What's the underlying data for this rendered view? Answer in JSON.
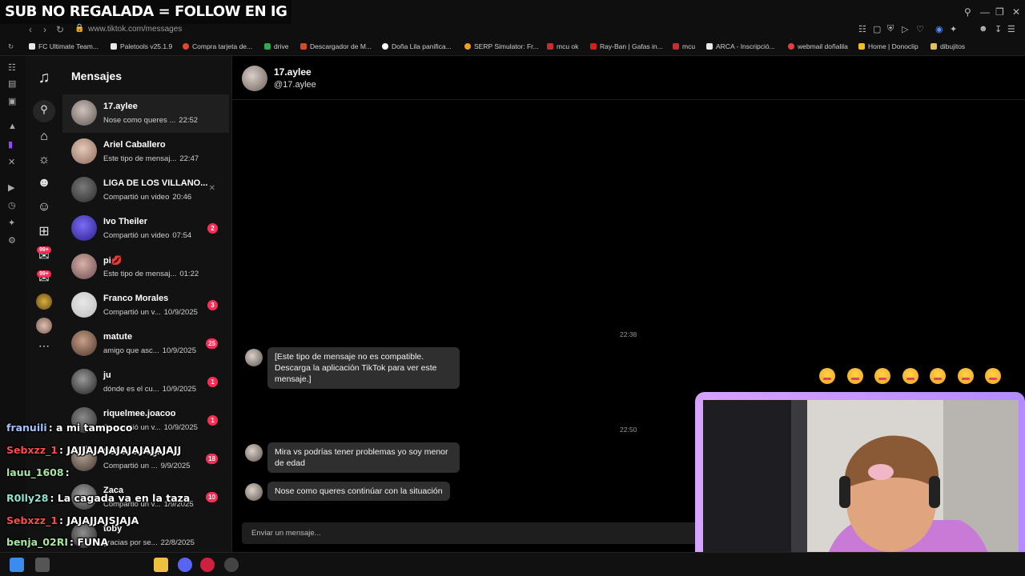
{
  "browser": {
    "banner": "SUB NO REGALADA = FOLLOW EN IG",
    "url": "www.tiktok.com/messages",
    "bookmarks": [
      "FC Ultimate Team...",
      "Paletools v25.1.9",
      "Compra tarjeta de...",
      "drive",
      "Descargador de M...",
      "Doña Lila panifica...",
      "SERP Simulator: Fr...",
      "mcu ok",
      "Ray-Ban | Gafas in...",
      "mcu",
      "ARCA - Inscripció...",
      "webmail doñalila",
      "Home | Donoclip",
      "dibujitos"
    ]
  },
  "tiktok_nav": {
    "badge_1": "99+",
    "badge_2": "99+"
  },
  "conversations": {
    "title": "Mensajes",
    "items": [
      {
        "name": "17.aylee",
        "preview": "Nose como queres ...",
        "time": "22:52",
        "badge": "",
        "colors": [
          "#cfc4bd",
          "#5e5450"
        ]
      },
      {
        "name": "Ariel Caballero",
        "preview": "Este tipo de mensaj...",
        "time": "22:47",
        "badge": "",
        "colors": [
          "#e6c9b8",
          "#8a6a5a"
        ]
      },
      {
        "name": "LIGA DE LOS VILLANO...",
        "preview": "Compartió un video",
        "time": "20:46",
        "badge": "",
        "colors": [
          "#7a7a7a",
          "#2a2a2a"
        ]
      },
      {
        "name": "Ivo Theiler",
        "preview": "Compartió un video",
        "time": "07:54",
        "badge": "2",
        "colors": [
          "#7b6cf5",
          "#2b1f8a"
        ]
      },
      {
        "name": "pi💋",
        "preview": "Este tipo de mensaj...",
        "time": "01:22",
        "badge": "",
        "colors": [
          "#d8b1a8",
          "#6a4a50"
        ]
      },
      {
        "name": "Franco Morales",
        "preview": "Compartió un v...",
        "time": "10/9/2025",
        "badge": "3",
        "colors": [
          "#e8e8e8",
          "#bdbdbd"
        ]
      },
      {
        "name": "matute",
        "preview": "amigo que asc...",
        "time": "10/9/2025",
        "badge": "25",
        "colors": [
          "#c9a08a",
          "#4a3428"
        ]
      },
      {
        "name": "ju",
        "preview": "dónde es el cu...",
        "time": "10/9/2025",
        "badge": "1",
        "colors": [
          "#9a9a9a",
          "#1f1f1f"
        ]
      },
      {
        "name": "riquelmee.joacoo",
        "preview": "Compartió un v...",
        "time": "10/9/2025",
        "badge": "1",
        "colors": [
          "#8a8a8a",
          "#2c2c2c"
        ]
      },
      {
        "name": "Roberto Gugl...",
        "preview": "Compartió un ...",
        "time": "9/9/2025",
        "badge": "18",
        "colors": [
          "#b0a090",
          "#403530"
        ]
      },
      {
        "name": "Zaca",
        "preview": "Compartió un v...",
        "time": "1/9/2025",
        "badge": "10",
        "colors": [
          "#a0a0a0",
          "#303030"
        ]
      },
      {
        "name": "toby",
        "preview": "gracias por se...",
        "time": "22/8/2025",
        "badge": "",
        "colors": [
          "#909090",
          "#202020"
        ]
      }
    ]
  },
  "chat": {
    "name": "17.aylee",
    "handle": "@17.aylee",
    "timestamp_1": "22:38",
    "timestamp_2": "22:50",
    "messages": [
      "[Este tipo de mensaje no es compatible. Descarga la aplicación TikTok para ver este mensaje.]",
      "Mira vs podrías tener problemas yo soy menor de edad",
      "Nose como queres continúar con la situación"
    ],
    "input_placeholder": "Enviar un mensaje..."
  },
  "stream_chat": [
    {
      "user": "franuili",
      "text": ": a mi tampoco",
      "color": "#9ec5ff"
    },
    {
      "user": "Sebxzz_1",
      "text": ": JAJJAJAJAJAJAJAJAJAJJ",
      "color": "#ff4a4a"
    },
    {
      "user": "lauu_1608",
      "text": ":",
      "color": "#a7e6a0"
    },
    {
      "user": "R0lly28",
      "text": ": La cagada va en la taza",
      "color": "#8fe3d0"
    },
    {
      "user": "Sebxzz_1",
      "text": ": JAJAJJAJSJAJA",
      "color": "#ff4a4a"
    },
    {
      "user": "benja_02RI",
      "text": ": FUNA",
      "color": "#a7e6a0"
    },
    {
      "user": "Sebxzz_1",
      "text": ": PRIMERA FUNA",
      "color": "#ff4a4a"
    }
  ],
  "colors": {
    "accent": "#fe2c55",
    "cam_border": "#c79bff"
  }
}
